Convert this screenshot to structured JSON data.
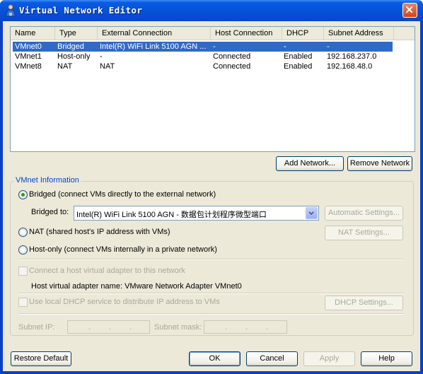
{
  "window": {
    "title": "Virtual Network Editor"
  },
  "table": {
    "columns": [
      "Name",
      "Type",
      "External Connection",
      "Host Connection",
      "DHCP",
      "Subnet Address"
    ],
    "rows": [
      {
        "name": "VMnet0",
        "type": "Bridged",
        "external": "Intel(R) WiFi Link 5100 AGN ...",
        "host": "-",
        "dhcp": "-",
        "subnet": "-"
      },
      {
        "name": "VMnet1",
        "type": "Host-only",
        "external": "-",
        "host": "Connected",
        "dhcp": "Enabled",
        "subnet": "192.168.237.0"
      },
      {
        "name": "VMnet8",
        "type": "NAT",
        "external": "NAT",
        "host": "Connected",
        "dhcp": "Enabled",
        "subnet": "192.168.48.0"
      }
    ]
  },
  "buttons": {
    "add_network": "Add Network...",
    "remove_network": "Remove Network",
    "automatic_settings": "Automatic Settings...",
    "nat_settings": "NAT Settings...",
    "dhcp_settings": "DHCP Settings...",
    "restore_default": "Restore Default",
    "ok": "OK",
    "cancel": "Cancel",
    "apply": "Apply",
    "help": "Help"
  },
  "vmnet_info": {
    "title": "VMnet Information",
    "bridged": "Bridged (connect VMs directly to the external network)",
    "bridged_to_label": "Bridged to:",
    "bridged_to_value": "Intel(R) WiFi Link 5100 AGN - 数据包计划程序微型端口",
    "nat": "NAT (shared host's IP address with VMs)",
    "host_only": "Host-only (connect VMs internally in a private network)",
    "connect_adapter": "Connect a host virtual adapter to this network",
    "adapter_name": "Host virtual adapter name: VMware Network Adapter VMnet0",
    "use_dhcp": "Use local DHCP service to distribute IP address to VMs",
    "subnet_ip_label": "Subnet IP:",
    "subnet_mask_label": "Subnet mask:",
    "selected_mode": "bridged"
  },
  "colors": {
    "selection": "#316ac5",
    "title_bar": "#0550d8",
    "dialog_bg": "#ece9d8",
    "group_title": "#0046d5"
  }
}
